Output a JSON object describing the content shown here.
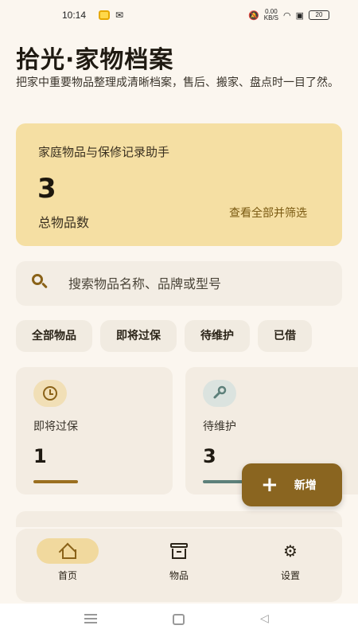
{
  "status_bar": {
    "time": "10:14",
    "net_speed_value": "0.00",
    "net_speed_unit": "KB/S",
    "battery": "20"
  },
  "header": {
    "title": "拾光·家物档案",
    "subtitle": "把家中重要物品整理成清晰档案，售后、搬家、盘点时一目了然。"
  },
  "hero": {
    "label": "家庭物品与保修记录助手",
    "count": "3",
    "count_label": "总物品数",
    "link": "查看全部并筛选"
  },
  "search": {
    "placeholder": "搜索物品名称、品牌或型号",
    "icon": "search-icon"
  },
  "filters": [
    {
      "label": "全部物品"
    },
    {
      "label": "即将过保"
    },
    {
      "label": "待维护"
    },
    {
      "label": "已借"
    }
  ],
  "stats": [
    {
      "label": "即将过保",
      "value": "1",
      "icon": "clock-icon"
    },
    {
      "label": "待维护",
      "value": "3",
      "icon": "wrench-icon"
    }
  ],
  "fab": {
    "icon": "+",
    "label": "新增"
  },
  "bottom_nav": [
    {
      "label": "首页",
      "icon": "home-icon",
      "active": true
    },
    {
      "label": "物品",
      "icon": "archive-icon",
      "active": false
    },
    {
      "label": "设置",
      "icon": "gear-icon",
      "active": false
    }
  ],
  "colors": {
    "background": "#fbf6ef",
    "hero": "#f5dfa3",
    "accent": "#8a6520",
    "card": "#f3ece2"
  }
}
